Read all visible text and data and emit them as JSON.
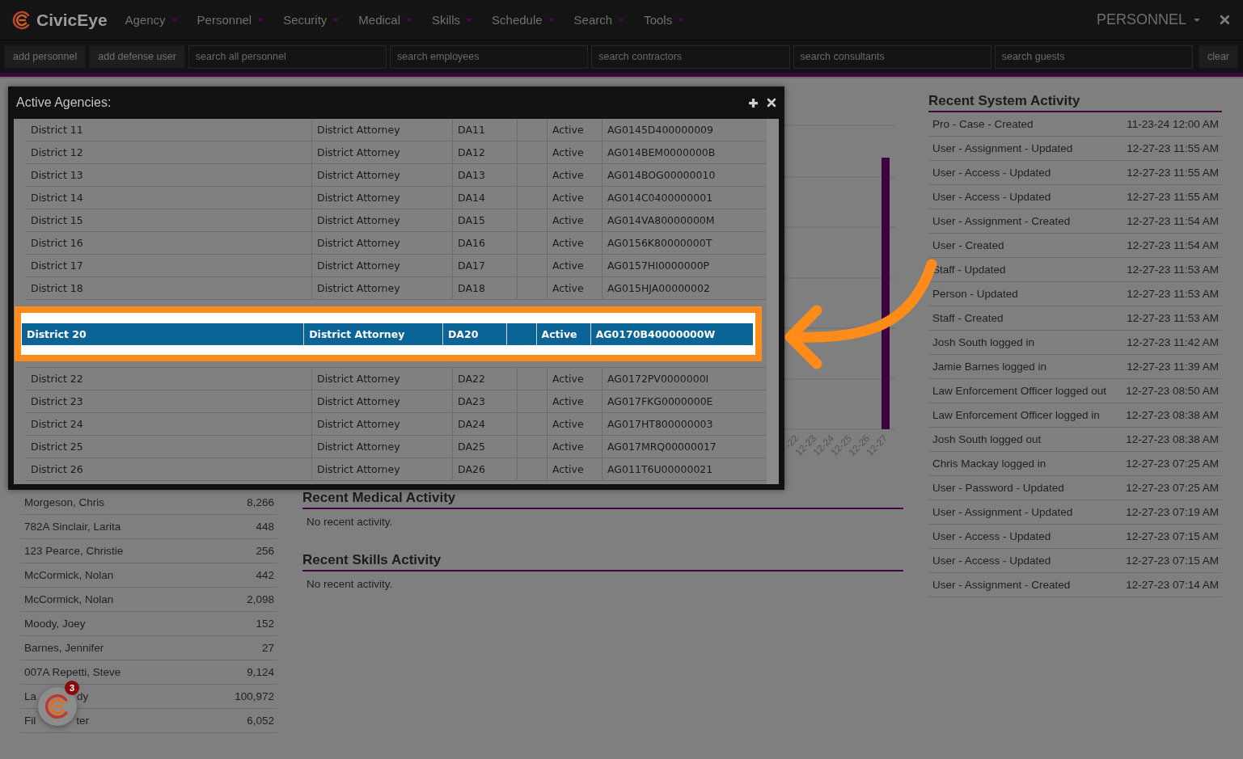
{
  "nav": {
    "brand": "CivicEye",
    "menu": [
      "Agency",
      "Personnel",
      "Security",
      "Medical",
      "Skills",
      "Schedule",
      "Search",
      "Tools"
    ],
    "section": "PERSONNEL"
  },
  "toolbar": {
    "buttons": [
      "add personnel",
      "add defense user"
    ],
    "searches": [
      {
        "placeholder": "search all personnel"
      },
      {
        "placeholder": "search employees"
      },
      {
        "placeholder": "search contractors"
      },
      {
        "placeholder": "search consultants"
      },
      {
        "placeholder": "search guests"
      }
    ],
    "clear": "clear"
  },
  "modal": {
    "title": "Active Agencies:",
    "rows": [
      {
        "name": "District 11",
        "type": "District Attorney",
        "code": "DA11",
        "status": "Active",
        "agency_id": "AG0145D400000009",
        "selected": false
      },
      {
        "name": "District 12",
        "type": "District Attorney",
        "code": "DA12",
        "status": "Active",
        "agency_id": "AG014BEM0000000B",
        "selected": false
      },
      {
        "name": "District 13",
        "type": "District Attorney",
        "code": "DA13",
        "status": "Active",
        "agency_id": "AG014BOG00000010",
        "selected": false
      },
      {
        "name": "District 14",
        "type": "District Attorney",
        "code": "DA14",
        "status": "Active",
        "agency_id": "AG014C0400000001",
        "selected": false
      },
      {
        "name": "District 15",
        "type": "District Attorney",
        "code": "DA15",
        "status": "Active",
        "agency_id": "AG014VA80000000M",
        "selected": false
      },
      {
        "name": "District 16",
        "type": "District Attorney",
        "code": "DA16",
        "status": "Active",
        "agency_id": "AG0156K80000000T",
        "selected": false
      },
      {
        "name": "District 17",
        "type": "District Attorney",
        "code": "DA17",
        "status": "Active",
        "agency_id": "AG0157HI0000000P",
        "selected": false
      },
      {
        "name": "District 18",
        "type": "District Attorney",
        "code": "DA18",
        "status": "Active",
        "agency_id": "AG015HJA00000002",
        "selected": false
      },
      {
        "name": "District 20",
        "type": "District Attorney",
        "code": "DA20",
        "status": "Active",
        "agency_id": "AG0170B40000000W",
        "selected": true
      },
      {
        "name": "District 22",
        "type": "District Attorney",
        "code": "DA22",
        "status": "Active",
        "agency_id": "AG0172PV0000000I",
        "selected": false
      },
      {
        "name": "District 23",
        "type": "District Attorney",
        "code": "DA23",
        "status": "Active",
        "agency_id": "AG017FKG0000000E",
        "selected": false
      },
      {
        "name": "District 24",
        "type": "District Attorney",
        "code": "DA24",
        "status": "Active",
        "agency_id": "AG017HT800000003",
        "selected": false
      },
      {
        "name": "District 25",
        "type": "District Attorney",
        "code": "DA25",
        "status": "Active",
        "agency_id": "AG017MRQ00000017",
        "selected": false
      },
      {
        "name": "District 26",
        "type": "District Attorney",
        "code": "DA26",
        "status": "Active",
        "agency_id": "AG011T6U00000021",
        "selected": false
      }
    ]
  },
  "chart": {
    "x_labels": [
      "-22",
      "12-23",
      "12-24",
      "12-25",
      "12-26",
      "12-27"
    ]
  },
  "people": [
    {
      "name": "Morgeson, Chris",
      "count": "8,266"
    },
    {
      "name": "782A Sinclair, Larita",
      "count": "448"
    },
    {
      "name": "123 Pearce, Christie",
      "count": "256"
    },
    {
      "name": "McCormick, Nolan",
      "count": "442"
    },
    {
      "name": "McCormick, Nolan",
      "count": "2,098"
    },
    {
      "name": "Moody, Joey",
      "count": "152"
    },
    {
      "name": "Barnes, Jennifer",
      "count": "27"
    },
    {
      "name": "007A Repetti, Steve",
      "count": "9,124"
    },
    {
      "name": "La",
      "name_end": "dy",
      "count": "100,972"
    },
    {
      "name": "Fil",
      "name_end": "ter",
      "count": "6,052"
    }
  ],
  "medical": {
    "title": "Recent Medical Activity",
    "message": "No recent activity."
  },
  "skills": {
    "title": "Recent Skills Activity",
    "message": "No recent activity."
  },
  "system_activity": {
    "title": "Recent System Activity",
    "items": [
      {
        "text": "Pro - Case - Created",
        "time": "11-23-24 12:00 AM"
      },
      {
        "text": "User - Assignment - Updated",
        "time": "12-27-23 11:55 AM"
      },
      {
        "text": "User - Access - Updated",
        "time": "12-27-23 11:55 AM"
      },
      {
        "text": "User - Access - Updated",
        "time": "12-27-23 11:55 AM"
      },
      {
        "text": "User - Assignment - Created",
        "time": "12-27-23 11:54 AM"
      },
      {
        "text": "User - Created",
        "time": "12-27-23 11:54 AM"
      },
      {
        "text": "Staff - Updated",
        "time": "12-27-23 11:53 AM"
      },
      {
        "text": "Person - Updated",
        "time": "12-27-23 11:53 AM"
      },
      {
        "text": "Staff - Created",
        "time": "12-27-23 11:53 AM"
      },
      {
        "text": "Josh South logged in",
        "time": "12-27-23 11:42 AM"
      },
      {
        "text": "Jamie Barnes logged in",
        "time": "12-27-23 11:39 AM"
      },
      {
        "text": "Law Enforcement Officer logged out",
        "time": "12-27-23 08:50 AM"
      },
      {
        "text": "Law Enforcement Officer logged in",
        "time": "12-27-23 08:38 AM"
      },
      {
        "text": "Josh South logged out",
        "time": "12-27-23 08:38 AM"
      },
      {
        "text": "Chris Mackay logged in",
        "time": "12-27-23 07:25 AM"
      },
      {
        "text": "User - Password - Updated",
        "time": "12-27-23 07:25 AM"
      },
      {
        "text": "User - Assignment - Updated",
        "time": "12-27-23 07:19 AM"
      },
      {
        "text": "User - Access - Updated",
        "time": "12-27-23 07:15 AM"
      },
      {
        "text": "User - Access - Updated",
        "time": "12-27-23 07:15 AM"
      },
      {
        "text": "User - Assignment - Created",
        "time": "12-27-23 07:14 AM"
      }
    ]
  },
  "notifications": {
    "count": "3"
  }
}
